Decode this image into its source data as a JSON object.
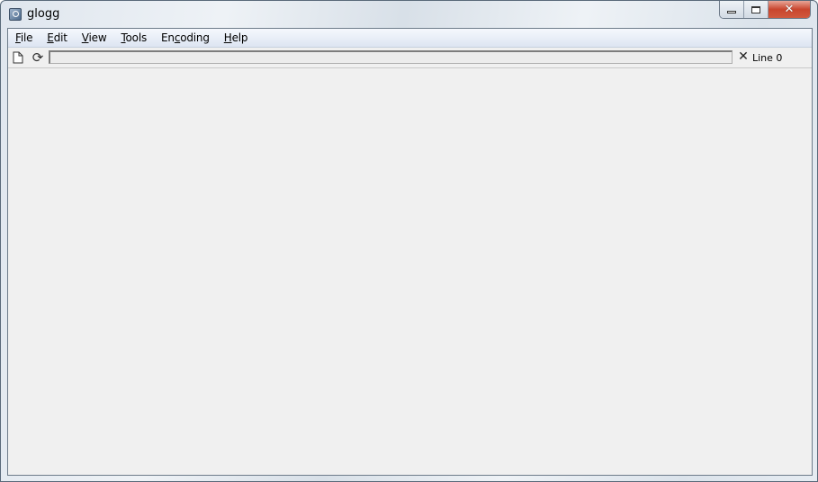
{
  "window": {
    "title": "glogg",
    "app_icon": "glogg-app-icon",
    "caption_buttons": {
      "minimize": "minimize-icon",
      "maximize": "maximize-icon",
      "close_glyph": "✕"
    }
  },
  "menubar": {
    "items": [
      {
        "mnemonic": "F",
        "rest": "ile",
        "prefix": ""
      },
      {
        "mnemonic": "E",
        "rest": "dit",
        "prefix": ""
      },
      {
        "mnemonic": "V",
        "rest": "iew",
        "prefix": ""
      },
      {
        "mnemonic": "T",
        "rest": "ools",
        "prefix": ""
      },
      {
        "prefix": "En",
        "mnemonic": "c",
        "rest": "oding"
      },
      {
        "mnemonic": "H",
        "rest": "elp",
        "prefix": ""
      }
    ]
  },
  "toolbar": {
    "open_icon": "open-file-icon",
    "reload_icon": "reload-icon",
    "reload_glyph": "⟳",
    "search_value": "",
    "clear_glyph": "✕",
    "line_label": "Line 0"
  }
}
